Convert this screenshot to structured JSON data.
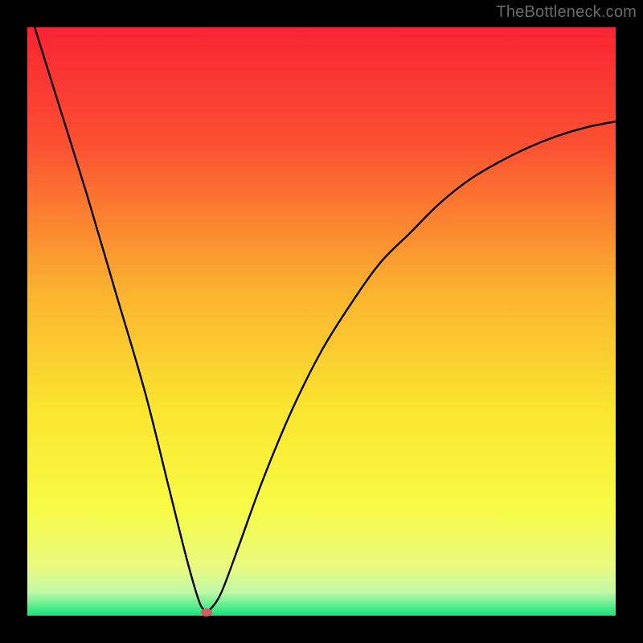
{
  "attribution": "TheBottleneck.com",
  "frame": {
    "outer_size_px": 800,
    "border_px": 34,
    "border_color": "#000000"
  },
  "gradient": {
    "stops": [
      {
        "pct": 0,
        "color": "#fa2432"
      },
      {
        "pct": 20,
        "color": "#fb5131"
      },
      {
        "pct": 45,
        "color": "#fbb330"
      },
      {
        "pct": 65,
        "color": "#fbe52f"
      },
      {
        "pct": 82,
        "color": "#f7fb46"
      },
      {
        "pct": 92,
        "color": "#e8fa82"
      },
      {
        "pct": 96,
        "color": "#c0f9a9"
      },
      {
        "pct": 100,
        "color": "#14e37b"
      }
    ]
  },
  "marker": {
    "x_pct": 30.5,
    "y_pct": 99.5,
    "color": "#c9605b"
  },
  "chart_data": {
    "type": "line",
    "title": "",
    "xlabel": "",
    "ylabel": "",
    "xlim": [
      0,
      100
    ],
    "ylim": [
      0,
      100
    ],
    "note": "Percent axes; x left→right, y bottom→top. No numeric axis ticks are shown in the image; values are read from pixel positions relative to the plot area.",
    "series": [
      {
        "name": "bottleneck-curve",
        "x": [
          0,
          5,
          10,
          15,
          20,
          24,
          27,
          29,
          30,
          31,
          33,
          36,
          40,
          45,
          50,
          55,
          60,
          65,
          70,
          75,
          80,
          85,
          90,
          95,
          100
        ],
        "y": [
          104,
          88,
          72,
          55,
          38,
          22,
          10,
          3,
          1,
          1,
          4,
          12,
          23,
          35,
          45,
          53,
          60,
          65,
          70,
          74,
          77,
          79.5,
          81.5,
          83,
          84
        ]
      }
    ],
    "annotations": [
      {
        "name": "minimum-marker",
        "x": 30.5,
        "y": 0.5
      }
    ]
  }
}
